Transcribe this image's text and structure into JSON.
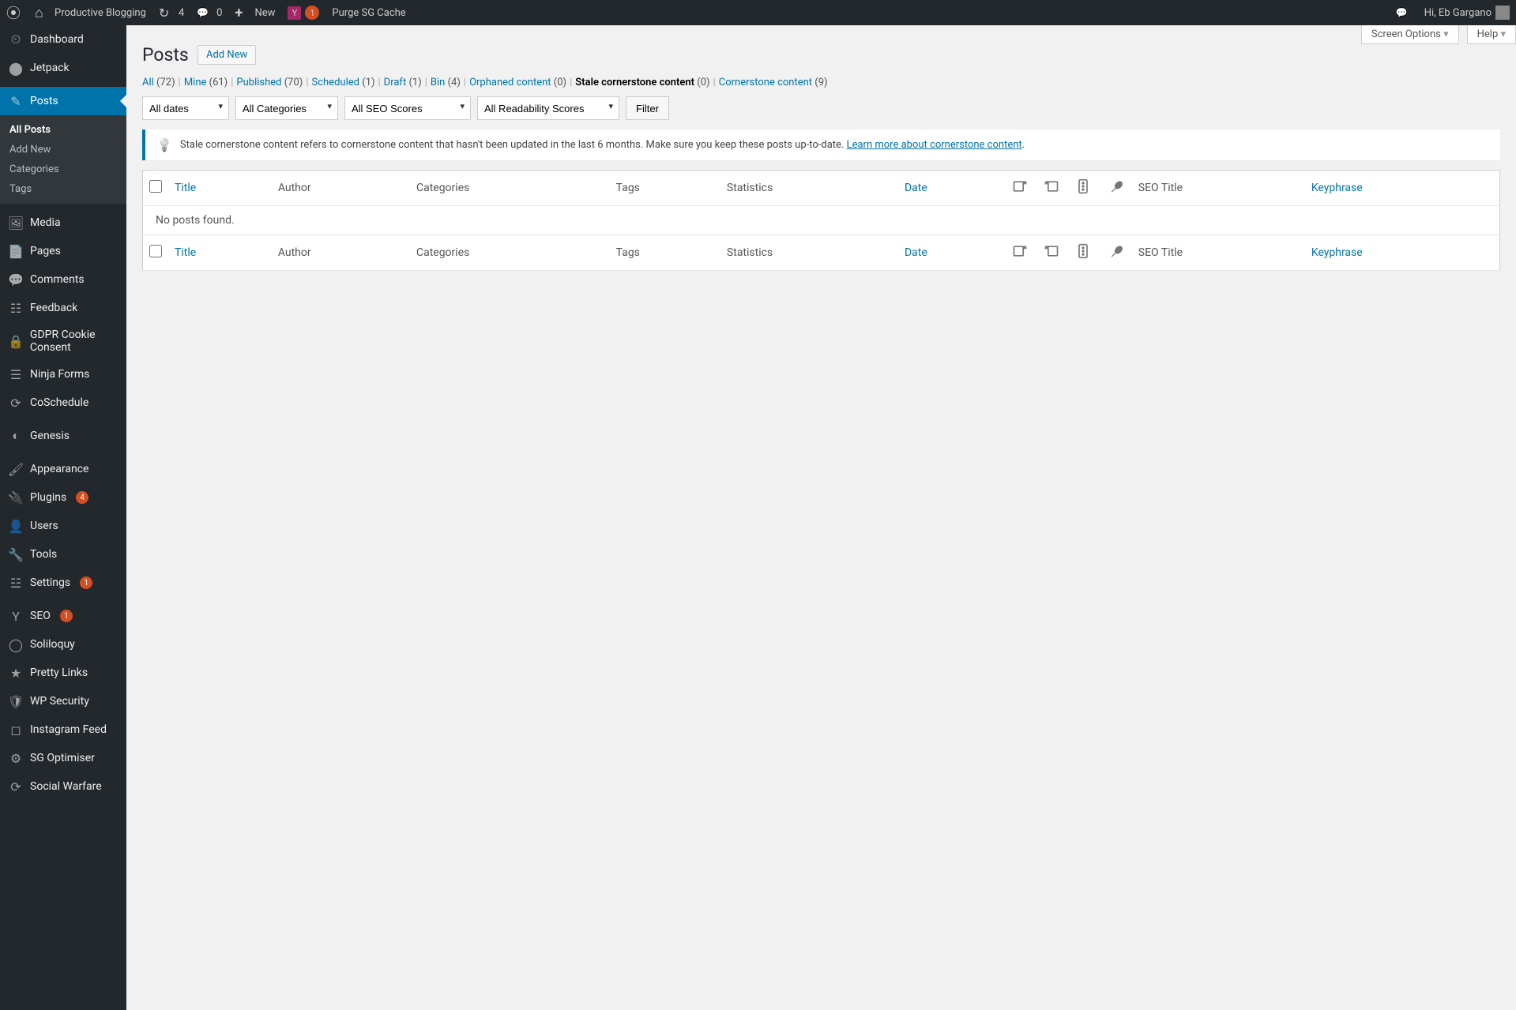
{
  "toolbar": {
    "site_name": "Productive Blogging",
    "refresh_count": "4",
    "comment_count": "0",
    "new_label": "New",
    "yoast_count": "1",
    "purge_label": "Purge SG Cache",
    "greeting_label": "Hi, Eb Gargano"
  },
  "sidebar": {
    "items": [
      {
        "label": "Dashboard",
        "icon": "⏲"
      },
      {
        "label": "Jetpack",
        "icon": "⬤"
      },
      {
        "label": "Posts",
        "icon": "✎",
        "active": true
      },
      {
        "label": "Media",
        "icon": "🖼"
      },
      {
        "label": "Pages",
        "icon": "📄"
      },
      {
        "label": "Comments",
        "icon": "💬"
      },
      {
        "label": "Feedback",
        "icon": "☷"
      },
      {
        "label": "GDPR Cookie Consent",
        "icon": "🔒"
      },
      {
        "label": "Ninja Forms",
        "icon": "☰"
      },
      {
        "label": "CoSchedule",
        "icon": "⟳"
      },
      {
        "label": "Genesis",
        "icon": "◐"
      },
      {
        "label": "Appearance",
        "icon": "🖌"
      },
      {
        "label": "Plugins",
        "icon": "🔌",
        "badge": "4"
      },
      {
        "label": "Users",
        "icon": "👤"
      },
      {
        "label": "Tools",
        "icon": "🔧"
      },
      {
        "label": "Settings",
        "icon": "☳",
        "badge": "1"
      },
      {
        "label": "SEO",
        "icon": "Y",
        "badge": "1"
      },
      {
        "label": "Soliloquy",
        "icon": "◯"
      },
      {
        "label": "Pretty Links",
        "icon": "★"
      },
      {
        "label": "WP Security",
        "icon": "🛡"
      },
      {
        "label": "Instagram Feed",
        "icon": "◻"
      },
      {
        "label": "SG Optimiser",
        "icon": "⚙"
      },
      {
        "label": "Social Warfare",
        "icon": "⟳"
      }
    ],
    "submenu": {
      "all_posts": "All Posts",
      "add_new": "Add New",
      "categories": "Categories",
      "tags": "Tags"
    }
  },
  "content": {
    "screen_options": "Screen Options",
    "help": "Help",
    "page_title": "Posts",
    "add_new": "Add New",
    "filter_links": [
      {
        "label": "All",
        "count": "(72)"
      },
      {
        "label": "Mine",
        "count": "(61)"
      },
      {
        "label": "Published",
        "count": "(70)"
      },
      {
        "label": "Scheduled",
        "count": "(1)"
      },
      {
        "label": "Draft",
        "count": "(1)"
      },
      {
        "label": "Bin",
        "count": "(4)"
      },
      {
        "label": "Orphaned content",
        "count": "(0)"
      },
      {
        "label": "Stale cornerstone content",
        "count": "(0)",
        "current": true
      },
      {
        "label": "Cornerstone content",
        "count": "(9)"
      }
    ],
    "filters": {
      "dates": "All dates",
      "categories": "All Categories",
      "seo": "All SEO Scores",
      "readability": "All Readability Scores",
      "button": "Filter"
    },
    "notice": {
      "text": "Stale cornerstone content refers to cornerstone content that hasn't been updated in the last 6 months. Make sure you keep these posts up-to-date. ",
      "link": "Learn more about cornerstone content",
      "suffix": "."
    },
    "columns": {
      "title": "Title",
      "author": "Author",
      "categories": "Categories",
      "tags": "Tags",
      "statistics": "Statistics",
      "date": "Date",
      "seo_title": "SEO Title",
      "keyphrase": "Keyphrase"
    },
    "no_posts": "No posts found."
  }
}
